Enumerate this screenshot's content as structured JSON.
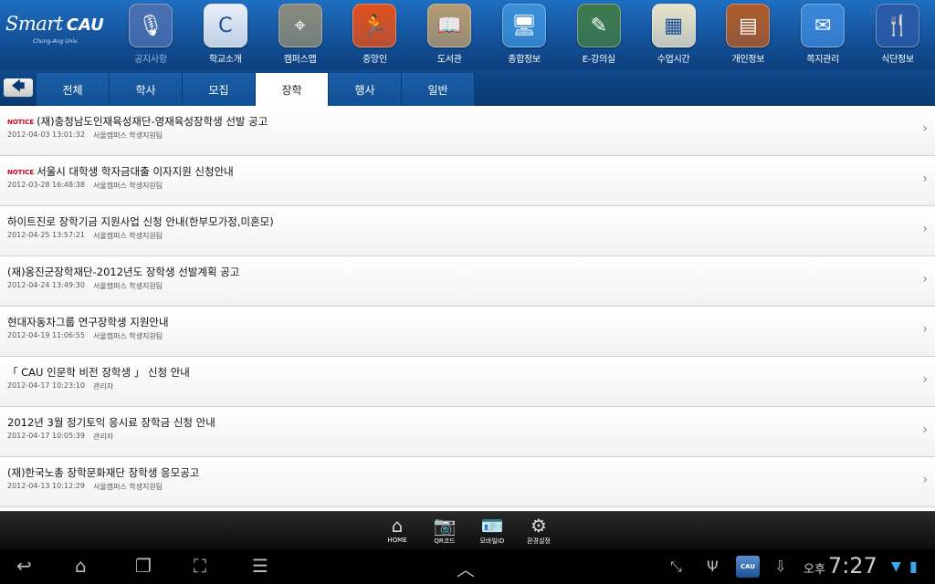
{
  "logo": {
    "main": "Smart",
    "cau": "CAU",
    "sub": "Chung-Ang Univ."
  },
  "apps": [
    {
      "name": "notice",
      "label": "공지사항",
      "icon": "🎙",
      "color": "#4a6fb0",
      "active": true
    },
    {
      "name": "school-intro",
      "label": "학교소개",
      "icon": "C",
      "color": "#e8eef7",
      "active": false
    },
    {
      "name": "campus-map",
      "label": "캠퍼스맵",
      "icon": "⌖",
      "color": "#8a8a7a",
      "active": false
    },
    {
      "name": "chungang-person",
      "label": "중앙인",
      "icon": "🏃",
      "color": "#e0501c",
      "active": false
    },
    {
      "name": "library",
      "label": "도서관",
      "icon": "📖",
      "color": "#b49a70",
      "active": false
    },
    {
      "name": "general-info",
      "label": "종합정보",
      "icon": "🖥",
      "color": "#3a8fd8",
      "active": false
    },
    {
      "name": "e-classroom",
      "label": "E-강의실",
      "icon": "✎",
      "color": "#3e7a4a",
      "active": false
    },
    {
      "name": "class-time",
      "label": "수업시간",
      "icon": "▦",
      "color": "#e8e2c8",
      "active": false
    },
    {
      "name": "personal-info",
      "label": "개인정보",
      "icon": "▤",
      "color": "#b05a28",
      "active": false
    },
    {
      "name": "message-manage",
      "label": "쪽지관리",
      "icon": "✉",
      "color": "#3a86d8",
      "active": false
    },
    {
      "name": "menu-info",
      "label": "식단정보",
      "icon": "🍴",
      "color": "#2a5aa8",
      "active": false
    }
  ],
  "tabs": [
    {
      "label": "전체",
      "active": false
    },
    {
      "label": "학사",
      "active": false
    },
    {
      "label": "모집",
      "active": false
    },
    {
      "label": "장학",
      "active": true
    },
    {
      "label": "행사",
      "active": false
    },
    {
      "label": "일반",
      "active": false
    }
  ],
  "back_icon": "🡄",
  "notice_tag": "NOTICE",
  "rows": [
    {
      "notice": true,
      "title": "(재)충청남도인재육성재단-영재육성장학생 선발 공고",
      "date": "2012-04-03 13:01:32",
      "dept": "서울캠퍼스 학생지원팀"
    },
    {
      "notice": true,
      "title": "서울시 대학생 학자금대출 이자지원 신청안내",
      "date": "2012-03-28 16:48:38",
      "dept": "서울캠퍼스 학생지원팀"
    },
    {
      "notice": false,
      "title": "하이트진로 장학기금 지원사업 신청 안내(한부모가정,미혼모)",
      "date": "2012-04-25 13:57:21",
      "dept": "서울캠퍼스 학생지원팀"
    },
    {
      "notice": false,
      "title": "(재)옹진군장학재단-2012년도 장학생 선발계획 공고",
      "date": "2012-04-24 13:49:30",
      "dept": "서울캠퍼스 학생지원팀"
    },
    {
      "notice": false,
      "title": "현대자동차그룹 연구장학생 지원안내",
      "date": "2012-04-19 11:06:55",
      "dept": "서울캠퍼스 학생지원팀"
    },
    {
      "notice": false,
      "title": "「 CAU 인문학 비전 장학생 」 신청 안내",
      "date": "2012-04-17 10:23:10",
      "dept": "관리자"
    },
    {
      "notice": false,
      "title": "2012년 3월 정기토익 응시료 장학금 신청 안내",
      "date": "2012-04-17 10:05:39",
      "dept": "관리자"
    },
    {
      "notice": false,
      "title": "(재)한국노총 장학문화재단 장학생 응모공고",
      "date": "2012-04-13 10:12:29",
      "dept": "서울캠퍼스 학생지원팀"
    }
  ],
  "dock": [
    {
      "name": "home",
      "label": "HOME",
      "icon": "⌂"
    },
    {
      "name": "qr-code",
      "label": "QR코드",
      "icon": "📷"
    },
    {
      "name": "mobile-id",
      "label": "모바일ID",
      "icon": "🪪"
    },
    {
      "name": "settings",
      "label": "환경설정",
      "icon": "⚙"
    }
  ],
  "system": {
    "ampm": "오후",
    "time": "7:27",
    "cau_mini": "CAU"
  }
}
